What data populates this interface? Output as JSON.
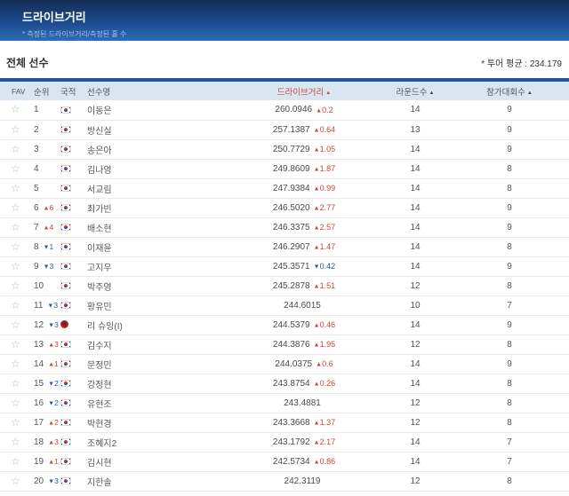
{
  "banner": {
    "title": "드라이브거리",
    "subtitle": "* 측정된 드라이브거리/측정된 홀 수"
  },
  "section": {
    "left_label": "전체 선수",
    "tour_average": "* 투어 평균 : 234.179"
  },
  "colors": {
    "up_red": "#c8473f",
    "down_blue": "#2d55a5",
    "banner_top": "#122c55",
    "banner_bottom": "#2e6db6",
    "header_bg": "#d9e6ef",
    "table_top_border": "#24549d",
    "star_green": "#9dd29d"
  },
  "table": {
    "headers": {
      "fav": "FAV",
      "rank": "순위",
      "nation": "국적",
      "name": "선수명",
      "distance": "드라이브거리",
      "rounds": "라운드수",
      "events": "참가대회수",
      "sort_arrow": "▲"
    },
    "rows": [
      {
        "rank": "1",
        "rank_dir": "",
        "rank_change": "",
        "nation": "KR",
        "name": "이동은",
        "value": "260.0946",
        "value_dir": "up",
        "value_change": "0.2",
        "rounds": "14",
        "events": "9"
      },
      {
        "rank": "2",
        "rank_dir": "",
        "rank_change": "",
        "nation": "KR",
        "name": "방신실",
        "value": "257.1387",
        "value_dir": "up",
        "value_change": "0.64",
        "rounds": "13",
        "events": "9"
      },
      {
        "rank": "3",
        "rank_dir": "",
        "rank_change": "",
        "nation": "KR",
        "name": "송은아",
        "value": "250.7729",
        "value_dir": "up",
        "value_change": "1.05",
        "rounds": "14",
        "events": "9"
      },
      {
        "rank": "4",
        "rank_dir": "",
        "rank_change": "",
        "nation": "KR",
        "name": "김나영",
        "value": "249.8609",
        "value_dir": "up",
        "value_change": "1.87",
        "rounds": "14",
        "events": "8"
      },
      {
        "rank": "5",
        "rank_dir": "",
        "rank_change": "",
        "nation": "KR",
        "name": "서교림",
        "value": "247.9384",
        "value_dir": "up",
        "value_change": "0.99",
        "rounds": "14",
        "events": "8"
      },
      {
        "rank": "6",
        "rank_dir": "up",
        "rank_change": "6",
        "nation": "KR",
        "name": "최가빈",
        "value": "246.5020",
        "value_dir": "up",
        "value_change": "2.77",
        "rounds": "14",
        "events": "9"
      },
      {
        "rank": "7",
        "rank_dir": "up",
        "rank_change": "4",
        "nation": "KR",
        "name": "배소현",
        "value": "246.3375",
        "value_dir": "up",
        "value_change": "2.57",
        "rounds": "14",
        "events": "9"
      },
      {
        "rank": "8",
        "rank_dir": "down",
        "rank_change": "1",
        "nation": "KR",
        "name": "이재윤",
        "value": "246.2907",
        "value_dir": "up",
        "value_change": "1.47",
        "rounds": "14",
        "events": "8"
      },
      {
        "rank": "9",
        "rank_dir": "down",
        "rank_change": "3",
        "nation": "KR",
        "name": "고지우",
        "value": "245.3571",
        "value_dir": "down",
        "value_change": "0.42",
        "rounds": "14",
        "events": "9"
      },
      {
        "rank": "10",
        "rank_dir": "",
        "rank_change": "",
        "nation": "KR",
        "name": "박주영",
        "value": "245.2878",
        "value_dir": "up",
        "value_change": "1.51",
        "rounds": "12",
        "events": "8"
      },
      {
        "rank": "11",
        "rank_dir": "down",
        "rank_change": "3",
        "nation": "KR",
        "name": "황유민",
        "value": "244.6015",
        "value_dir": "",
        "value_change": "",
        "rounds": "10",
        "events": "7"
      },
      {
        "rank": "12",
        "rank_dir": "down",
        "rank_change": "3",
        "nation": "CN",
        "name": "리 슈잉(I)",
        "value": "244.5379",
        "value_dir": "up",
        "value_change": "0.46",
        "rounds": "14",
        "events": "9"
      },
      {
        "rank": "13",
        "rank_dir": "up",
        "rank_change": "3",
        "nation": "KR",
        "name": "김수지",
        "value": "244.3876",
        "value_dir": "up",
        "value_change": "1.95",
        "rounds": "12",
        "events": "8"
      },
      {
        "rank": "14",
        "rank_dir": "up",
        "rank_change": "1",
        "nation": "KR",
        "name": "문정민",
        "value": "244.0375",
        "value_dir": "up",
        "value_change": "0.6",
        "rounds": "14",
        "events": "9"
      },
      {
        "rank": "15",
        "rank_dir": "down",
        "rank_change": "2",
        "nation": "KR",
        "name": "강정현",
        "value": "243.8754",
        "value_dir": "up",
        "value_change": "0.26",
        "rounds": "14",
        "events": "8"
      },
      {
        "rank": "16",
        "rank_dir": "down",
        "rank_change": "2",
        "nation": "KR",
        "name": "유현조",
        "value": "243.4881",
        "value_dir": "",
        "value_change": "",
        "rounds": "12",
        "events": "8"
      },
      {
        "rank": "17",
        "rank_dir": "up",
        "rank_change": "2",
        "nation": "KR",
        "name": "박현경",
        "value": "243.3668",
        "value_dir": "up",
        "value_change": "1.37",
        "rounds": "12",
        "events": "8"
      },
      {
        "rank": "18",
        "rank_dir": "up",
        "rank_change": "3",
        "nation": "KR",
        "name": "조혜지2",
        "value": "243.1792",
        "value_dir": "up",
        "value_change": "2.17",
        "rounds": "14",
        "events": "7"
      },
      {
        "rank": "19",
        "rank_dir": "up",
        "rank_change": "1",
        "nation": "KR",
        "name": "김시현",
        "value": "242.5734",
        "value_dir": "up",
        "value_change": "0.86",
        "rounds": "14",
        "events": "7"
      },
      {
        "rank": "20",
        "rank_dir": "down",
        "rank_change": "3",
        "nation": "KR",
        "name": "지한솔",
        "value": "242.3119",
        "value_dir": "",
        "value_change": "",
        "rounds": "12",
        "events": "8"
      }
    ]
  },
  "icons": {
    "up_arrow": "▲",
    "down_arrow": "▼",
    "favorite_star": "☆"
  }
}
